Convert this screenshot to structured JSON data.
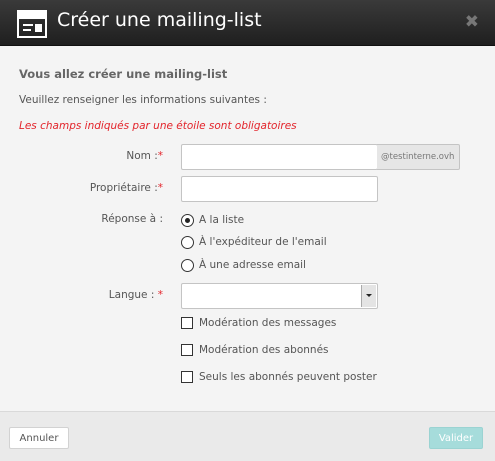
{
  "dialog": {
    "title": "Créer une mailing-list",
    "close_symbol": "✖",
    "icon": "mailing-list-icon"
  },
  "form": {
    "heading": "Vous allez créer une mailing-list",
    "intro": "Veuillez renseigner les informations suivantes :",
    "required_note": "Les champs indiqués par une étoile sont obligatoires",
    "required_mark": "*",
    "name": {
      "label": "Nom :",
      "value": "",
      "domain_suffix": "@testinterne.ovh"
    },
    "owner": {
      "label": "Propriétaire :",
      "value": ""
    },
    "reply_to": {
      "label": "Réponse à :",
      "options": [
        "A la liste",
        "À l'expéditeur de l'email",
        "À une adresse email"
      ],
      "selected_index": 0
    },
    "language": {
      "label": "Langue :",
      "value": ""
    },
    "options": [
      {
        "label": "Modération des messages",
        "checked": false
      },
      {
        "label": "Modération des abonnés",
        "checked": false
      },
      {
        "label": "Seuls les abonnés peuvent poster",
        "checked": false
      }
    ]
  },
  "footer": {
    "cancel_label": "Annuler",
    "validate_label": "Valider"
  },
  "colors": {
    "titlebar": "#2b2b2b",
    "required": "#e3242b",
    "validate_button": "#a6dcdb"
  }
}
